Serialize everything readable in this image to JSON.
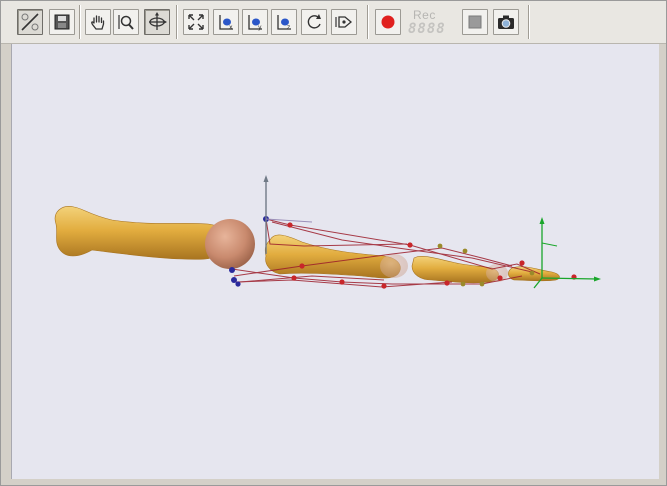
{
  "toolbar": {
    "buttons": [
      {
        "name": "on-off-toggle-button",
        "icon": "on-off-icon"
      },
      {
        "name": "save-button",
        "icon": "floppy-icon"
      },
      {
        "name": "pan-button",
        "icon": "hand-icon"
      },
      {
        "name": "zoom-button",
        "icon": "magnifier-icon"
      },
      {
        "name": "rotate-button",
        "icon": "rotate-axes-icon",
        "active": true
      },
      {
        "name": "fit-view-button",
        "icon": "fit-arrows-icon"
      },
      {
        "name": "view-x-button",
        "icon": "axis-view-icon"
      },
      {
        "name": "view-y-button",
        "icon": "axis-view-icon"
      },
      {
        "name": "view-z-button",
        "icon": "axis-view-icon"
      },
      {
        "name": "reset-rotation-button",
        "icon": "rotate-reset-icon"
      },
      {
        "name": "speed-button",
        "icon": "speed-arrow-icon"
      },
      {
        "name": "record-button",
        "icon": "record-icon"
      },
      {
        "name": "stop-button",
        "icon": "stop-icon"
      },
      {
        "name": "camera-button",
        "icon": "camera-icon"
      }
    ],
    "record_label": "Rec",
    "record_counter": "8888",
    "colors": {
      "record": "#e0201e",
      "stop": "#9a9a9a",
      "icon": "#333333"
    }
  },
  "viewport": {
    "background": "#e6e6ef",
    "colors": {
      "bone": "#e2ad3f",
      "bone_dark": "#a87420",
      "joint": "#c98a6e",
      "muscle_line": "#9c1d2a",
      "marker_red": "#c8262a",
      "marker_olive": "#9a8a2a",
      "marker_blue": "#2a2a9c",
      "axis_green": "#1aa62b",
      "axis_gray": "#707a86"
    }
  }
}
